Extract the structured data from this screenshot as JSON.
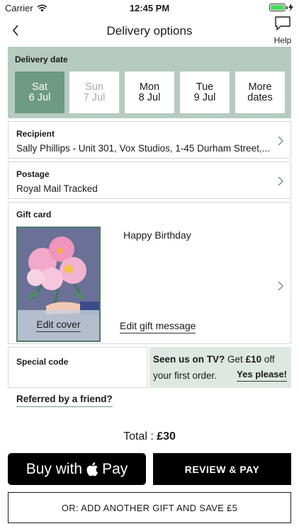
{
  "status_bar": {
    "carrier": "Carrier",
    "time": "12:45 PM"
  },
  "nav": {
    "title": "Delivery options",
    "help_label": "Help"
  },
  "delivery_date": {
    "title": "Delivery date",
    "dates": [
      {
        "day": "Sat",
        "date": "6 Jul",
        "state": "selected"
      },
      {
        "day": "Sun",
        "date": "7 Jul",
        "state": "disabled"
      },
      {
        "day": "Mon",
        "date": "8 Jul",
        "state": "available"
      },
      {
        "day": "Tue",
        "date": "9 Jul",
        "state": "available"
      },
      {
        "day": "More",
        "date": "dates",
        "state": "available"
      }
    ]
  },
  "recipient": {
    "title": "Recipient",
    "value": "Sally Phillips - Unit 301, Vox Studios, 1-45 Durham Street,..."
  },
  "postage": {
    "title": "Postage",
    "value": "Royal Mail Tracked"
  },
  "gift_card": {
    "title": "Gift card",
    "message": "Happy Birthday",
    "edit_cover": "Edit cover",
    "edit_message": "Edit gift message"
  },
  "special_code": {
    "label": "Special code"
  },
  "promo": {
    "bold_lead": "Seen us on TV?",
    "get": "Get",
    "amount": "£10",
    "rest": "off your first order.",
    "cta": "Yes please!"
  },
  "referred": "Referred by a friend?",
  "total": {
    "label": "Total :",
    "amount": "£30"
  },
  "buttons": {
    "apple_pay_prefix": "Buy with",
    "apple_pay_word": "Pay",
    "review_pay": "REVIEW & PAY",
    "add_gift": "OR: ADD ANOTHER GIFT AND SAVE £5"
  },
  "colors": {
    "accent_green": "#6e9a81",
    "date_panel": "#b5cbbf",
    "promo_bg": "#dde8e1"
  }
}
